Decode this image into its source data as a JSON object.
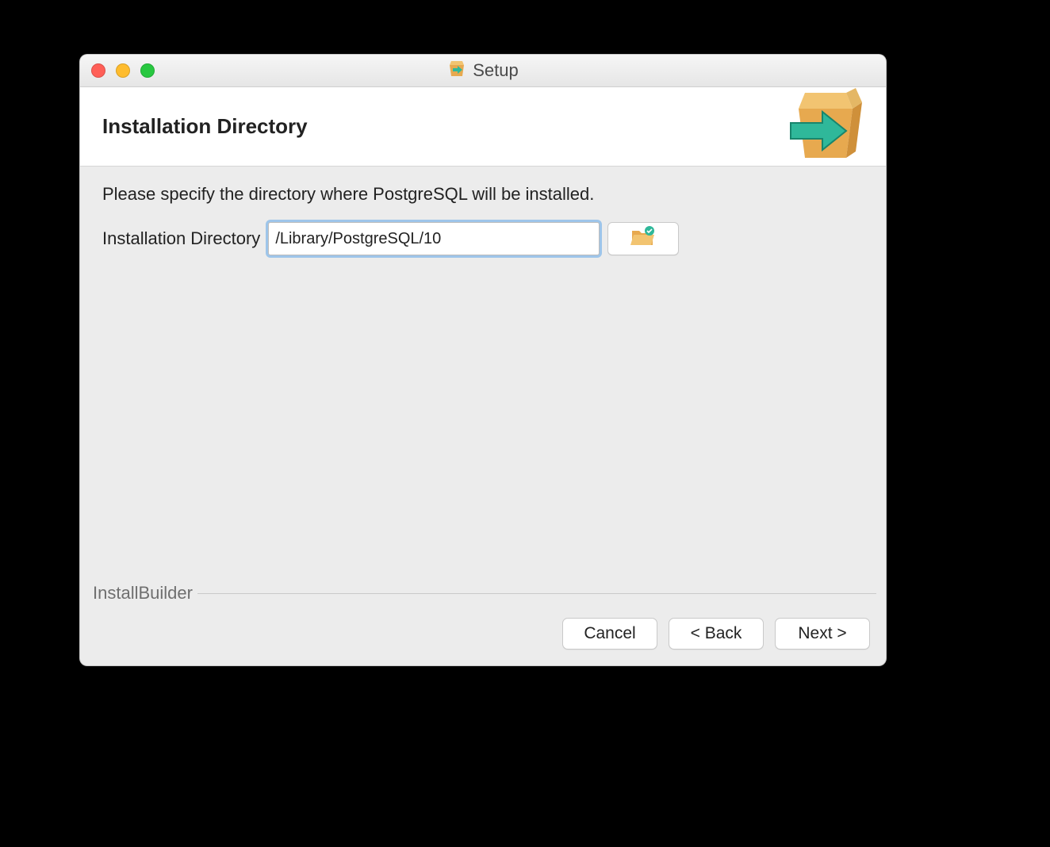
{
  "window": {
    "title": "Setup"
  },
  "header": {
    "title": "Installation Directory"
  },
  "content": {
    "instruction": "Please specify the directory where PostgreSQL will be installed.",
    "field_label": "Installation Directory",
    "directory_value": "/Library/PostgreSQL/10"
  },
  "footer": {
    "framework_label": "InstallBuilder",
    "cancel": "Cancel",
    "back": "< Back",
    "next": "Next >"
  },
  "icons": {
    "title_icon": "box-arrow-icon",
    "header_icon": "box-arrow-large-icon",
    "browse_icon": "folder-open-icon"
  },
  "colors": {
    "accent_teal": "#2fb89a",
    "box_tan": "#e7a94f"
  }
}
